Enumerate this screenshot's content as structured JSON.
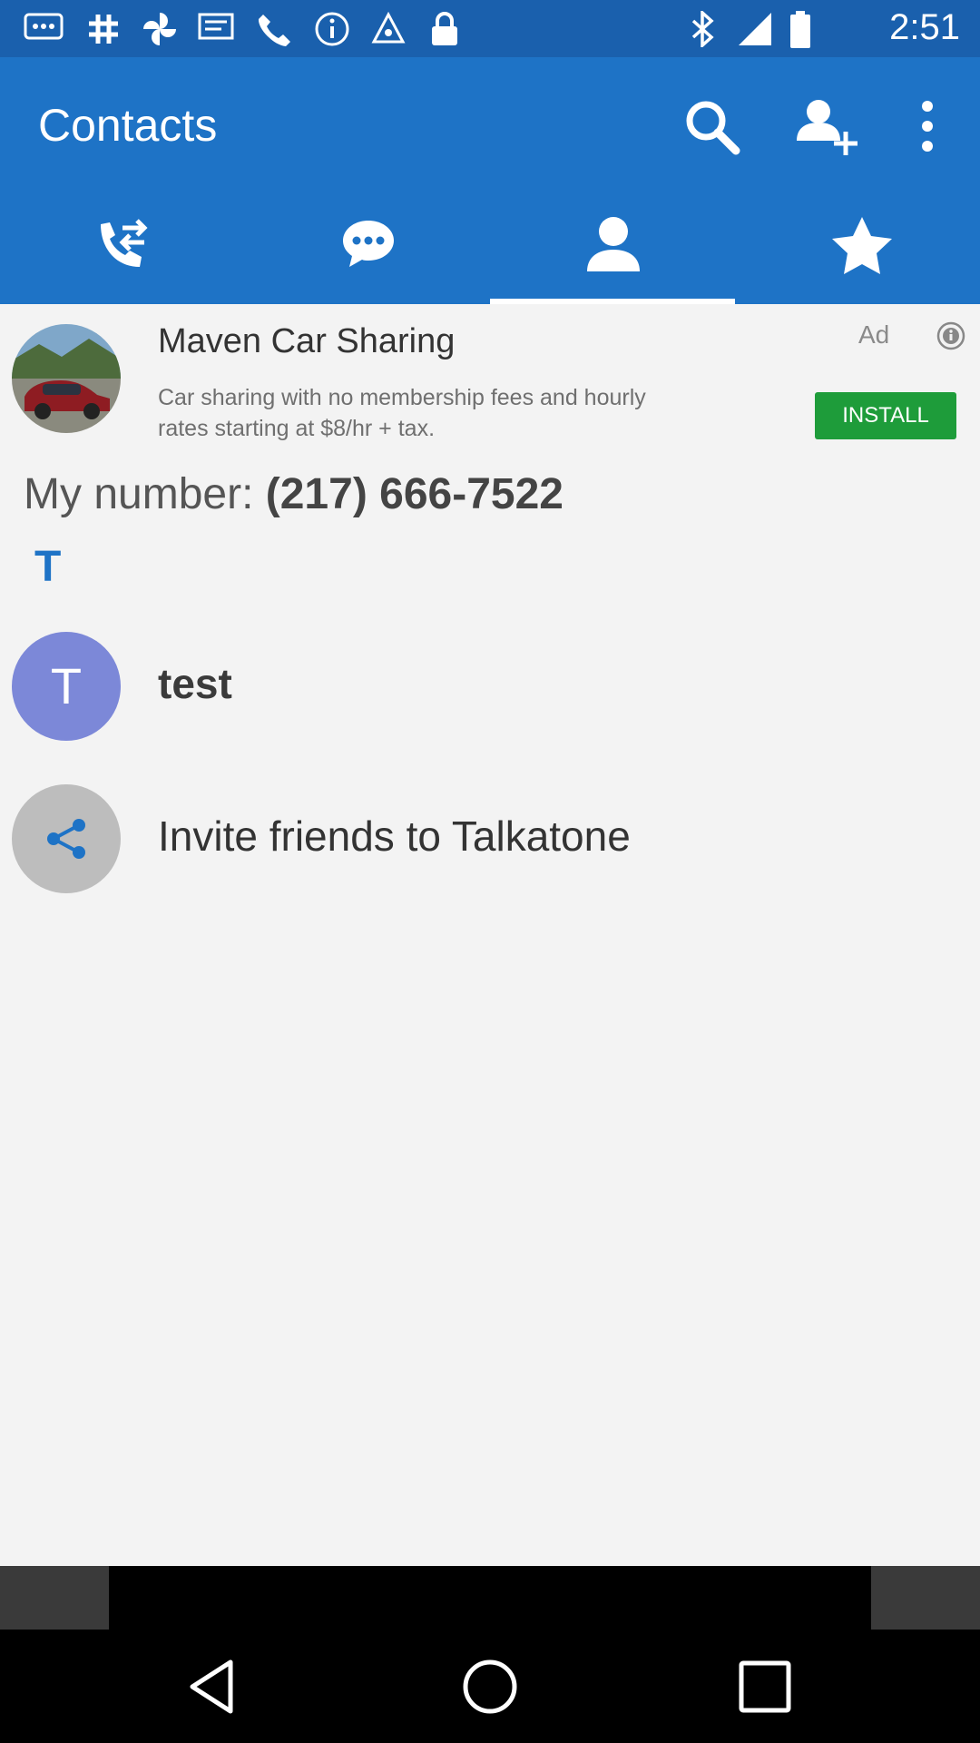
{
  "status_bar": {
    "time": "2:51",
    "icons": [
      "messages-icon",
      "slack-icon",
      "photos-icon",
      "message-icon",
      "phone-icon",
      "info-icon",
      "fake-gps-icon",
      "lock-icon",
      "bluetooth-icon",
      "signal-icon",
      "battery-icon"
    ]
  },
  "app_bar": {
    "title": "Contacts",
    "actions": [
      "search-icon",
      "add-contact-icon",
      "more-options-icon"
    ]
  },
  "tabs": [
    {
      "icon": "call-transfer-icon",
      "selected": false
    },
    {
      "icon": "chat-icon",
      "selected": false
    },
    {
      "icon": "contact-icon",
      "selected": true
    },
    {
      "icon": "star-icon",
      "selected": false
    }
  ],
  "ad": {
    "title": "Maven Car Sharing",
    "description": "Car sharing with no membership fees and hourly rates starting at $8/hr + tax.",
    "label": "Ad",
    "install_label": "INSTALL"
  },
  "my_number": {
    "prefix": "My number: ",
    "number": "(217) 666-7522"
  },
  "section_letter": "T",
  "contacts": [
    {
      "initial": "T",
      "name": "test"
    }
  ],
  "invite": {
    "label": "Invite friends to Talkatone"
  },
  "colors": {
    "primary": "#1e73c6",
    "status_bar": "#1a60ad",
    "install": "#1e9c3a",
    "avatar_t": "#7c88d8",
    "invite_avatar": "#bdbdbd",
    "background": "#f3f3f3"
  }
}
